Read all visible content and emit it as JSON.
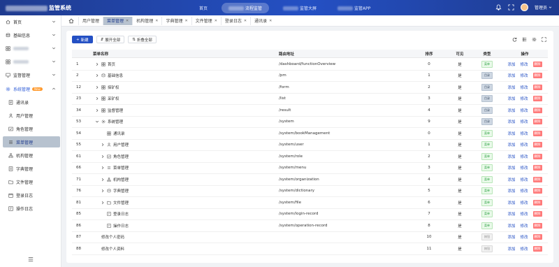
{
  "header": {
    "app_title": "监管系统",
    "nav": [
      {
        "label": "首页",
        "active": false
      },
      {
        "label": "流程监管",
        "active": true
      },
      {
        "label": "监管大屏",
        "active": false
      },
      {
        "label": "监管APP",
        "active": false
      }
    ],
    "user_name": "管理员",
    "icons": [
      "bell-icon",
      "fullscreen-icon",
      "avatar",
      "chevron-down-icon"
    ]
  },
  "sidebar": {
    "items": [
      {
        "label": "首页",
        "icon": "home-icon"
      },
      {
        "label": "基础信息",
        "icon": "database-icon"
      },
      {
        "label": "",
        "icon": "grid-icon"
      },
      {
        "label": "",
        "icon": "grid-icon"
      },
      {
        "label": "监督管理",
        "icon": "monitor-icon"
      },
      {
        "label": "系统管理",
        "icon": "gear-icon",
        "badge": "New"
      }
    ],
    "sub_items": [
      {
        "label": "通讯录",
        "icon": "contacts-icon"
      },
      {
        "label": "用户管理",
        "icon": "user-icon"
      },
      {
        "label": "角色管理",
        "icon": "role-icon"
      },
      {
        "label": "菜单管理",
        "icon": "menu-icon",
        "active": true
      },
      {
        "label": "机构管理",
        "icon": "org-icon"
      },
      {
        "label": "字典管理",
        "icon": "dictionary-icon"
      },
      {
        "label": "文件管理",
        "icon": "file-icon"
      },
      {
        "label": "登录日志",
        "icon": "log-icon"
      },
      {
        "label": "操作日志",
        "icon": "log-icon"
      }
    ]
  },
  "tabs": [
    {
      "label": "用户管理",
      "active": false
    },
    {
      "label": "菜单管理",
      "active": true
    },
    {
      "label": "机构管理",
      "active": false
    },
    {
      "label": "字典管理",
      "active": false
    },
    {
      "label": "文件管理",
      "active": false
    },
    {
      "label": "登录日志",
      "active": false
    },
    {
      "label": "通讯录",
      "active": false
    }
  ],
  "toolbar": {
    "new_label": "新建",
    "expand_label": "展开全部",
    "collapse_label": "折叠全部"
  },
  "table": {
    "columns": [
      "菜单名称",
      "路由地址",
      "排序",
      "可见",
      "类型",
      "操作"
    ],
    "actions": {
      "add": "添加",
      "edit": "修改",
      "delete": "删除"
    },
    "rows": [
      {
        "id": "1",
        "name": "首页",
        "path": "/dashboard/functionOverview",
        "order": "0",
        "visible": "是",
        "type": "菜单",
        "type_kind": "menu",
        "indent": 0,
        "expander": "right",
        "icon": "grid-icon"
      },
      {
        "id": "2",
        "name": "基础信息",
        "path": "/pm",
        "order": "1",
        "visible": "是",
        "type": "目录",
        "type_kind": "dir",
        "indent": 0,
        "expander": "right",
        "icon": "database-icon"
      },
      {
        "id": "12",
        "name": "探矿权",
        "path": "/form",
        "order": "2",
        "visible": "是",
        "type": "目录",
        "type_kind": "dir",
        "indent": 0,
        "expander": "right",
        "icon": "grid-icon"
      },
      {
        "id": "23",
        "name": "采矿权",
        "path": "/list",
        "order": "3",
        "visible": "是",
        "type": "目录",
        "type_kind": "dir",
        "indent": 0,
        "expander": "right",
        "icon": "grid-icon"
      },
      {
        "id": "34",
        "name": "监督管理",
        "path": "/result",
        "order": "4",
        "visible": "是",
        "type": "目录",
        "type_kind": "dir",
        "indent": 0,
        "expander": "right",
        "icon": "grid-icon"
      },
      {
        "id": "53",
        "name": "系统管理",
        "path": "/system",
        "order": "9",
        "visible": "是",
        "type": "目录",
        "type_kind": "dir",
        "indent": 0,
        "expander": "down",
        "icon": "gear-icon"
      },
      {
        "id": "54",
        "name": "通讯录",
        "path": "/system/bookManagement",
        "order": "0",
        "visible": "是",
        "type": "菜单",
        "type_kind": "menu",
        "indent": 1,
        "expander": "",
        "icon": "grid-icon"
      },
      {
        "id": "55",
        "name": "用户管理",
        "path": "/system/user",
        "order": "1",
        "visible": "是",
        "type": "菜单",
        "type_kind": "menu",
        "indent": 1,
        "expander": "right",
        "icon": "user-icon"
      },
      {
        "id": "61",
        "name": "角色管理",
        "path": "/system/role",
        "order": "2",
        "visible": "是",
        "type": "菜单",
        "type_kind": "menu",
        "indent": 1,
        "expander": "right",
        "icon": "role-icon"
      },
      {
        "id": "66",
        "name": "菜单管理",
        "path": "/system/menu",
        "order": "3",
        "visible": "是",
        "type": "菜单",
        "type_kind": "menu",
        "indent": 1,
        "expander": "right",
        "icon": "menu-icon"
      },
      {
        "id": "71",
        "name": "机构管理",
        "path": "/system/organization",
        "order": "4",
        "visible": "是",
        "type": "菜单",
        "type_kind": "menu",
        "indent": 1,
        "expander": "right",
        "icon": "org-icon"
      },
      {
        "id": "76",
        "name": "字典管理",
        "path": "/system/dictionary",
        "order": "5",
        "visible": "是",
        "type": "菜单",
        "type_kind": "menu",
        "indent": 1,
        "expander": "right",
        "icon": "dictionary-icon"
      },
      {
        "id": "81",
        "name": "文件管理",
        "path": "/system/file",
        "order": "6",
        "visible": "是",
        "type": "菜单",
        "type_kind": "menu",
        "indent": 1,
        "expander": "right",
        "icon": "file-icon"
      },
      {
        "id": "85",
        "name": "登录日志",
        "path": "/system/login-record",
        "order": "7",
        "visible": "是",
        "type": "菜单",
        "type_kind": "menu",
        "indent": 1,
        "expander": "",
        "icon": "log-icon"
      },
      {
        "id": "86",
        "name": "操作日志",
        "path": "/system/operation-record",
        "order": "8",
        "visible": "是",
        "type": "菜单",
        "type_kind": "menu",
        "indent": 1,
        "expander": "",
        "icon": "log-icon"
      },
      {
        "id": "87",
        "name": "修改个人密码",
        "path": "",
        "order": "10",
        "visible": "是",
        "type": "按钮",
        "type_kind": "btnt",
        "indent": 0,
        "expander": "",
        "icon": ""
      },
      {
        "id": "88",
        "name": "修改个人资料",
        "path": "",
        "order": "11",
        "visible": "是",
        "type": "按钮",
        "type_kind": "btnt",
        "indent": 0,
        "expander": "",
        "icon": ""
      }
    ]
  }
}
